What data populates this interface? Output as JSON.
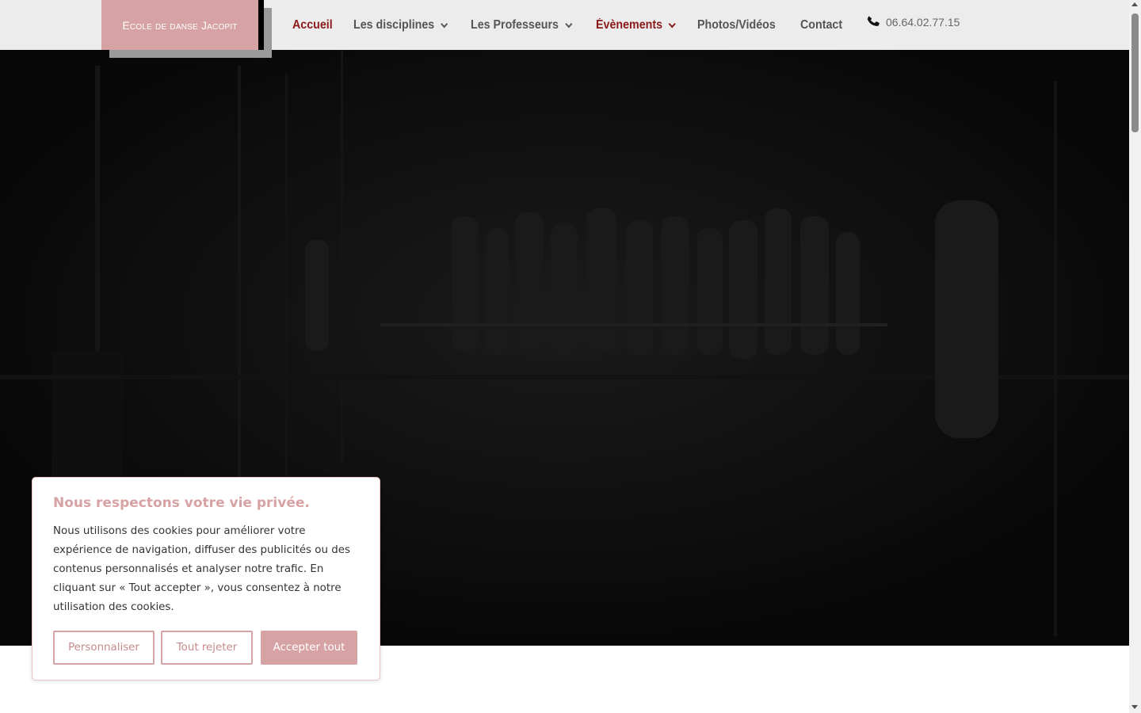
{
  "header": {
    "logo_text": "Ecole de danse Jacopit",
    "nav": [
      {
        "label": "Accueil",
        "active": true,
        "has_dropdown": false
      },
      {
        "label": "Les disciplines",
        "active": false,
        "has_dropdown": true
      },
      {
        "label": "Les Professeurs",
        "active": false,
        "has_dropdown": true
      },
      {
        "label": "Évènements",
        "active": true,
        "has_dropdown": true
      },
      {
        "label": "Photos/Vidéos",
        "active": false,
        "has_dropdown": false
      },
      {
        "label": "Contact",
        "active": false,
        "has_dropdown": false
      }
    ],
    "phone": "06.64.02.77.15",
    "phone_icon": "phone-icon"
  },
  "hero": {
    "image": "dark-photo-dance-studio-dancers-at-barre"
  },
  "cookie": {
    "title": "Nous respectons votre vie privée.",
    "text": "Nous utilisons des cookies pour améliorer votre expérience de navigation, diffuser des publicités ou des contenus personnalisés et analyser notre trafic. En cliquant sur « Tout accepter », vous consentez à notre utilisation des cookies.",
    "btn_customize": "Personnaliser",
    "btn_reject": "Tout rejeter",
    "btn_accept": "Accepter tout"
  },
  "colors": {
    "accent_pink": "#d7a2a3",
    "active_red": "#8b1a1a",
    "header_bg": "#ececec",
    "hero_bg": "#0c0c0c"
  }
}
